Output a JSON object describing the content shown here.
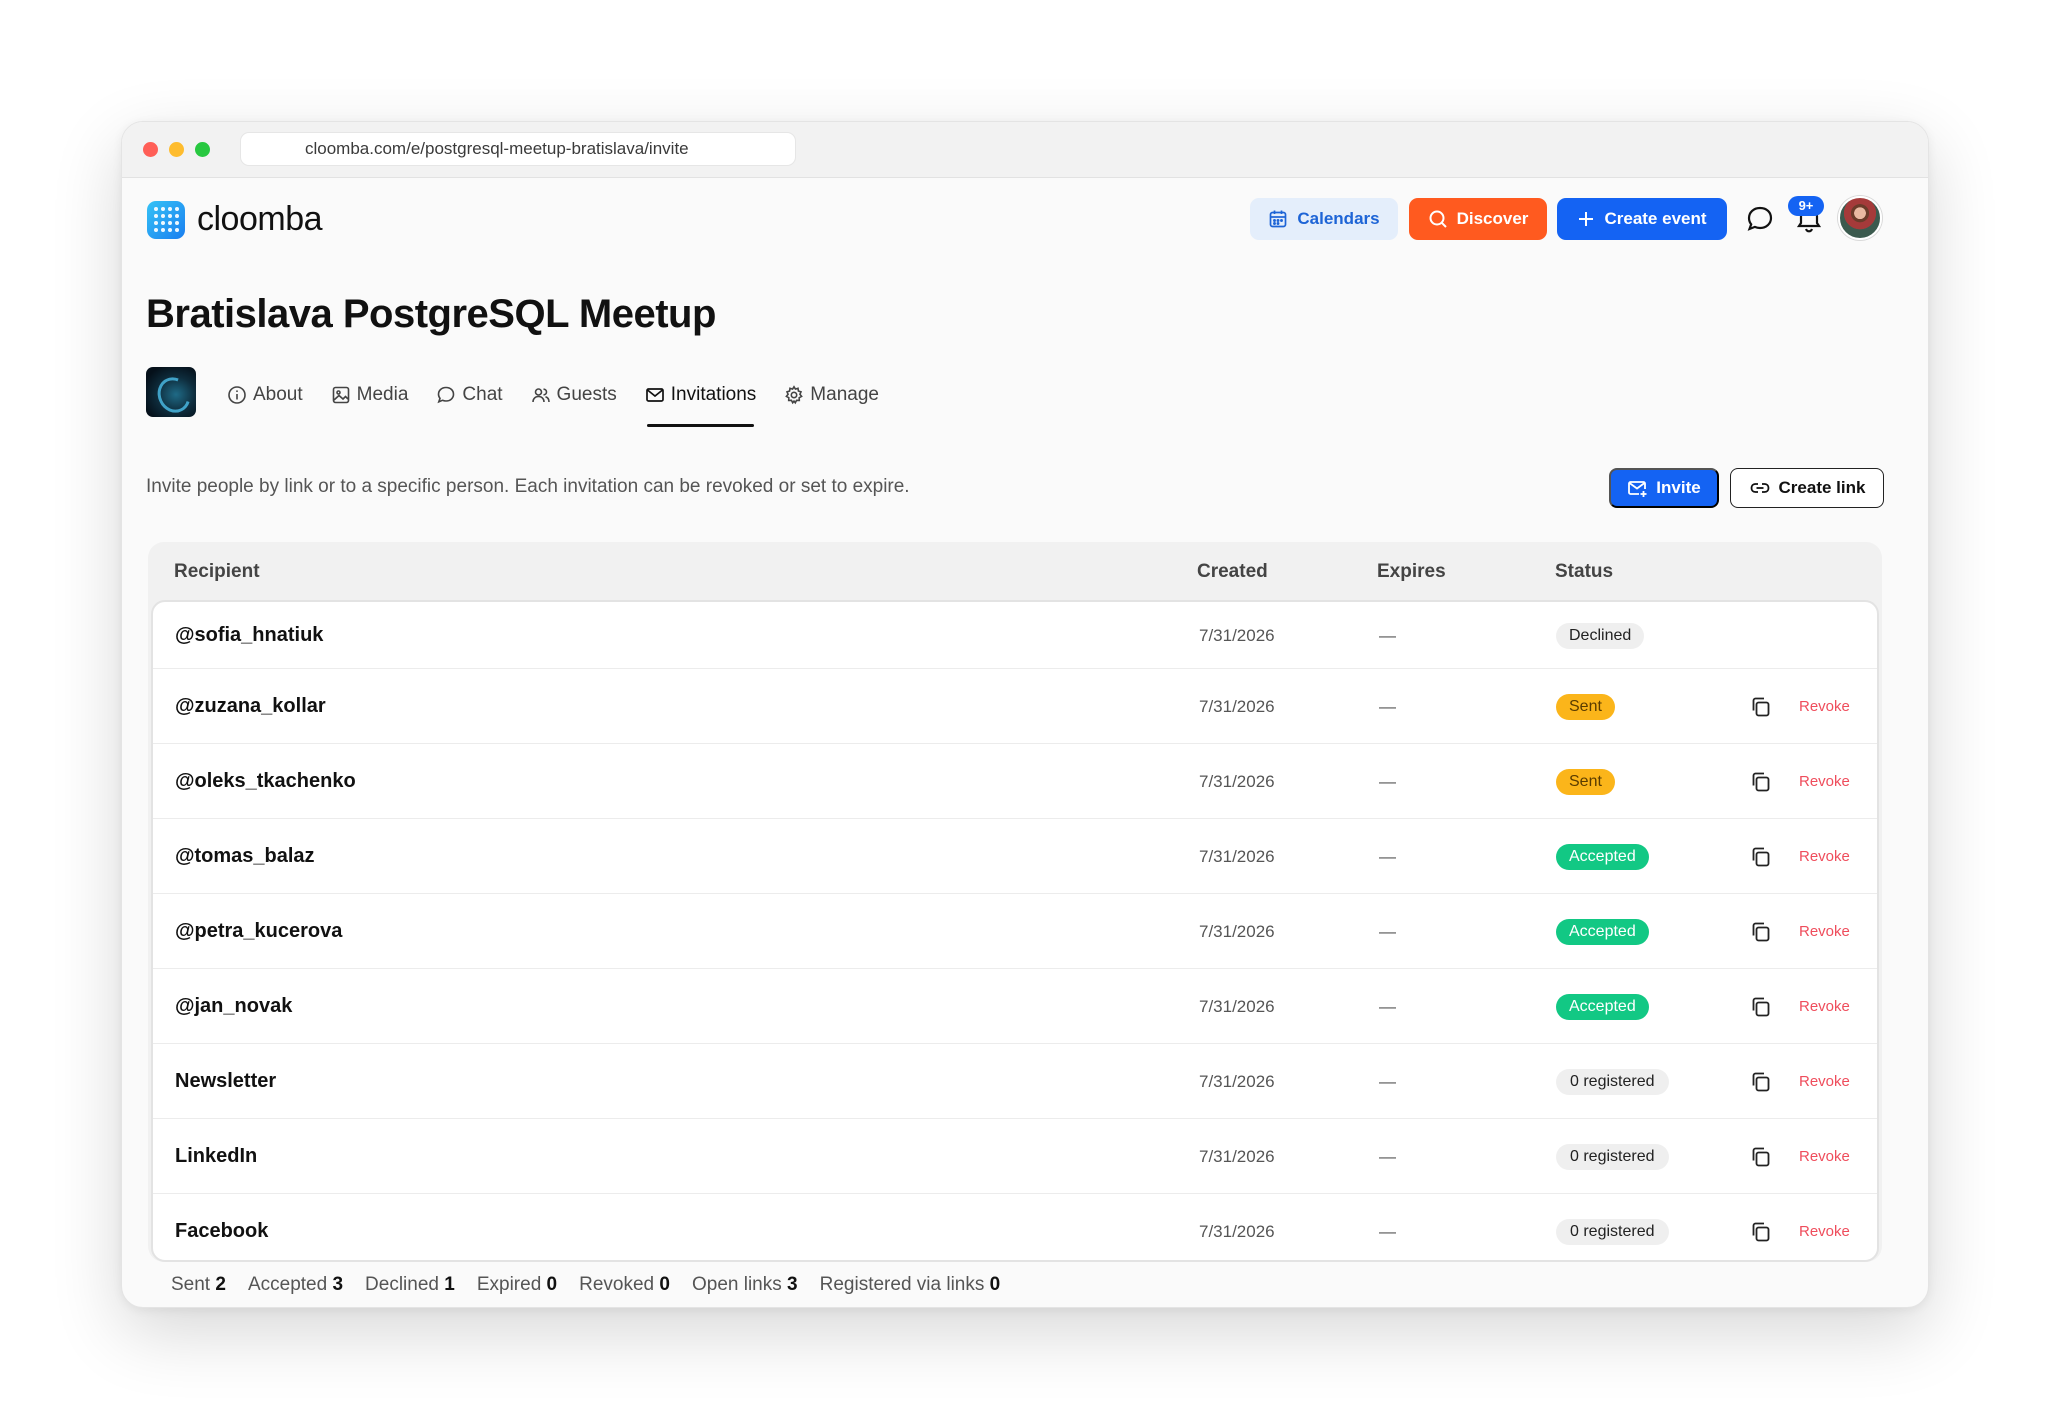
{
  "browser": {
    "url": "cloomba.com/e/postgresql-meetup-bratislava/invite"
  },
  "header": {
    "logo_text": "cloomba",
    "calendars_label": "Calendars",
    "discover_label": "Discover",
    "create_event_label": "Create event",
    "notifications_badge": "9+"
  },
  "event": {
    "title": "Bratislava PostgreSQL Meetup"
  },
  "tabs": [
    {
      "label": "About",
      "icon": "info-icon"
    },
    {
      "label": "Media",
      "icon": "image-icon"
    },
    {
      "label": "Chat",
      "icon": "chat-icon"
    },
    {
      "label": "Guests",
      "icon": "users-icon"
    },
    {
      "label": "Invitations",
      "icon": "mail-icon",
      "active": true
    },
    {
      "label": "Manage",
      "icon": "gear-icon"
    }
  ],
  "invitations": {
    "intro": "Invite people by link or to a specific person. Each invitation can be revoked or set to expire.",
    "invite_label": "Invite",
    "create_link_label": "Create link",
    "columns": {
      "recipient": "Recipient",
      "created": "Created",
      "expires": "Expires",
      "status": "Status"
    },
    "revoke_label": "Revoke",
    "rows": [
      {
        "recipient": "@sofia_hnatiuk",
        "created": "7/31/2026",
        "expires": "—",
        "status": "Declined",
        "kind": "declined",
        "actions": false
      },
      {
        "recipient": "@zuzana_kollar",
        "created": "7/31/2026",
        "expires": "—",
        "status": "Sent",
        "kind": "sent",
        "actions": true
      },
      {
        "recipient": "@oleks_tkachenko",
        "created": "7/31/2026",
        "expires": "—",
        "status": "Sent",
        "kind": "sent",
        "actions": true
      },
      {
        "recipient": "@tomas_balaz",
        "created": "7/31/2026",
        "expires": "—",
        "status": "Accepted",
        "kind": "accepted",
        "actions": true
      },
      {
        "recipient": "@petra_kucerova",
        "created": "7/31/2026",
        "expires": "—",
        "status": "Accepted",
        "kind": "accepted",
        "actions": true
      },
      {
        "recipient": "@jan_novak",
        "created": "7/31/2026",
        "expires": "—",
        "status": "Accepted",
        "kind": "accepted",
        "actions": true
      },
      {
        "recipient": "Newsletter",
        "created": "7/31/2026",
        "expires": "—",
        "status": "0 registered",
        "kind": "registered",
        "actions": true
      },
      {
        "recipient": "LinkedIn",
        "created": "7/31/2026",
        "expires": "—",
        "status": "0 registered",
        "kind": "registered",
        "actions": true
      },
      {
        "recipient": "Facebook",
        "created": "7/31/2026",
        "expires": "—",
        "status": "0 registered",
        "kind": "registered",
        "actions": true
      }
    ],
    "stats": [
      {
        "label": "Sent",
        "value": "2"
      },
      {
        "label": "Accepted",
        "value": "3"
      },
      {
        "label": "Declined",
        "value": "1"
      },
      {
        "label": "Expired",
        "value": "0"
      },
      {
        "label": "Revoked",
        "value": "0"
      },
      {
        "label": "Open links",
        "value": "3"
      },
      {
        "label": "Registered via links",
        "value": "0"
      }
    ]
  },
  "colors": {
    "primary": "#1463f3",
    "discover": "#ff5a1f",
    "sent": "#fbb51a",
    "accepted": "#12c884",
    "revoke": "#ef4d5c"
  }
}
